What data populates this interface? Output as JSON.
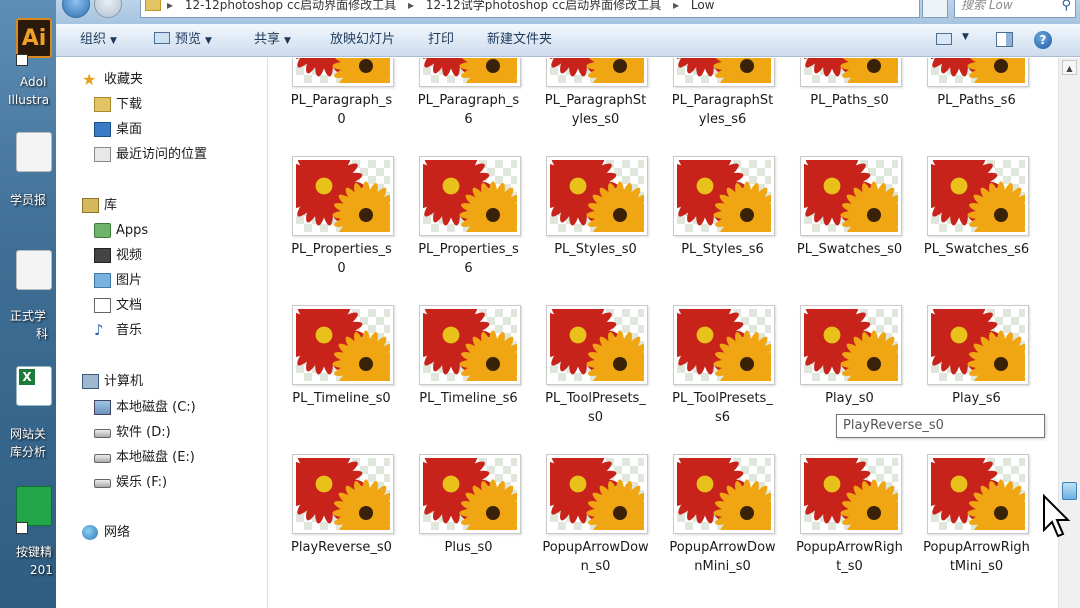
{
  "desktop": {
    "icons": [
      {
        "label1": "Adol",
        "label2": "Illustra"
      },
      {
        "label1": "学员报",
        "label2": ""
      },
      {
        "label1": "正式学",
        "label2": "科"
      },
      {
        "label1": "网站关",
        "label2": "库分析"
      },
      {
        "label1": "按键精",
        "label2": "201"
      }
    ]
  },
  "window": {
    "address": {
      "segments": [
        "12-12photoshop cc启动界面修改工具",
        "12-12试学photoshop cc启动界面修改工具",
        "Low"
      ]
    },
    "search": {
      "placeholder": "搜索 Low"
    },
    "toolbar": {
      "organize": "组织",
      "preview": "预览",
      "share": "共享",
      "slideshow": "放映幻灯片",
      "print": "打印",
      "new_folder": "新建文件夹"
    },
    "nav": {
      "favorites": "收藏夹",
      "downloads": "下载",
      "desktop": "桌面",
      "recent": "最近访问的位置",
      "libraries": "库",
      "apps": "Apps",
      "videos": "视频",
      "pictures": "图片",
      "documents": "文档",
      "music": "音乐",
      "computer": "计算机",
      "drive_c": "本地磁盘 (C:)",
      "drive_d": "软件 (D:)",
      "drive_e": "本地磁盘 (E:)",
      "drive_f": "娱乐 (F:)",
      "network": "网络"
    },
    "files": [
      [
        "PL_Paragraph_s0",
        "PL_Paragraph_s6",
        "PL_ParagraphStyles_s0",
        "PL_ParagraphStyles_s6",
        "PL_Paths_s0",
        "PL_Paths_s6"
      ],
      [
        "PL_Properties_s0",
        "PL_Properties_s6",
        "PL_Styles_s0",
        "PL_Styles_s6",
        "PL_Swatches_s0",
        "PL_Swatches_s6"
      ],
      [
        "PL_Timeline_s0",
        "PL_Timeline_s6",
        "PL_ToolPresets_s0",
        "PL_ToolPresets_s6",
        "Play_s0",
        "Play_s6"
      ],
      [
        "PlayReverse_s0",
        "Plus_s0",
        "PopupArrowDown_s0",
        "PopupArrowDownMini_s0",
        "PopupArrowRight_s0",
        "PopupArrowRightMini_s0"
      ]
    ],
    "tooltip": "PlayReverse_s0",
    "help": "?"
  }
}
